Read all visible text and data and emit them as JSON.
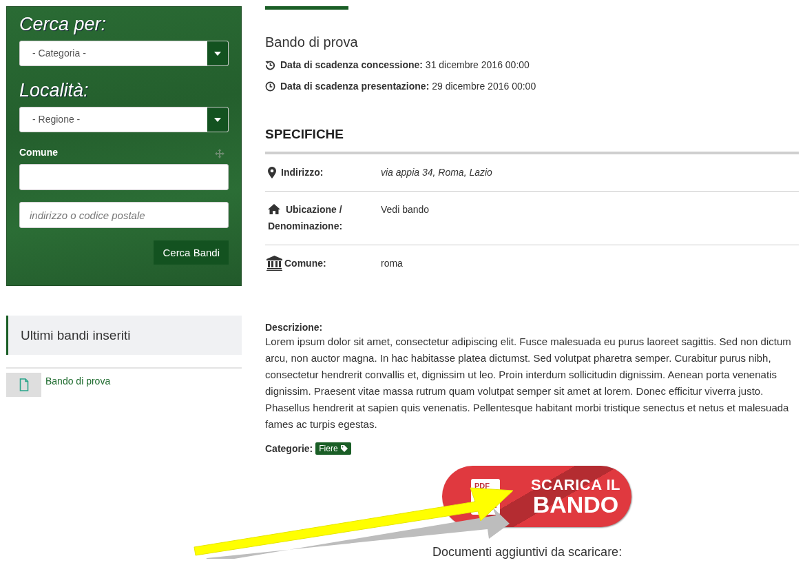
{
  "search": {
    "heading": "Cerca per:",
    "category_select": "- Categoria -",
    "location_heading": "Località:",
    "region_select": "- Regione -",
    "comune_label": "Comune",
    "address_placeholder": "indirizzo o codice postale",
    "button": "Cerca Bandi"
  },
  "latest": {
    "title": "Ultimi bandi inseriti",
    "items": [
      {
        "label": "Bando di prova"
      }
    ]
  },
  "detail": {
    "title": "Bando di prova",
    "dates": [
      {
        "kind": "concession",
        "label": "Data di scadenza concessione:",
        "value": "31 dicembre 2016 00:00"
      },
      {
        "kind": "presentation",
        "label": "Data di scadenza presentazione:",
        "value": "29 dicembre 2016 00:00"
      }
    ],
    "specs_title": "SPECIFICHE",
    "specs": [
      {
        "kind": "address",
        "label": "Indirizzo:",
        "value": "via appia 34, Roma, Lazio"
      },
      {
        "kind": "location",
        "label": "Ubicazione / Denominazione:",
        "value": "Vedi bando"
      },
      {
        "kind": "municipality",
        "label": "Comune:",
        "value": "roma"
      }
    ],
    "description_label": "Descrizione:",
    "description": "Lorem ipsum dolor sit amet, consectetur adipiscing elit. Fusce malesuada eu purus laoreet sagittis. Sed non dictum arcu, non auctor magna. In hac habitasse platea dictumst. Sed volutpat pharetra semper. Curabitur purus nibh, consectetur hendrerit convallis et, dignissim ut leo. Proin interdum sollicitudin dignissim. Aenean porta venenatis dignissim. Praesent vitae massa rutrum quam volutpat semper sit amet at lorem. Donec efficitur viverra justo. Phasellus hendrerit at sapien quis venenatis. Pellentesque habitant morbi tristique senectus et netus et malesuada fames ac turpis egestas.",
    "categories_label": "Categorie:",
    "categories": [
      {
        "label": "Fiere"
      }
    ],
    "download": {
      "pdf_label": "PDF",
      "line1": "SCARICA IL",
      "line2": "BANDO"
    },
    "extra_docs": "Documenti aggiuntivi da scaricare:"
  }
}
